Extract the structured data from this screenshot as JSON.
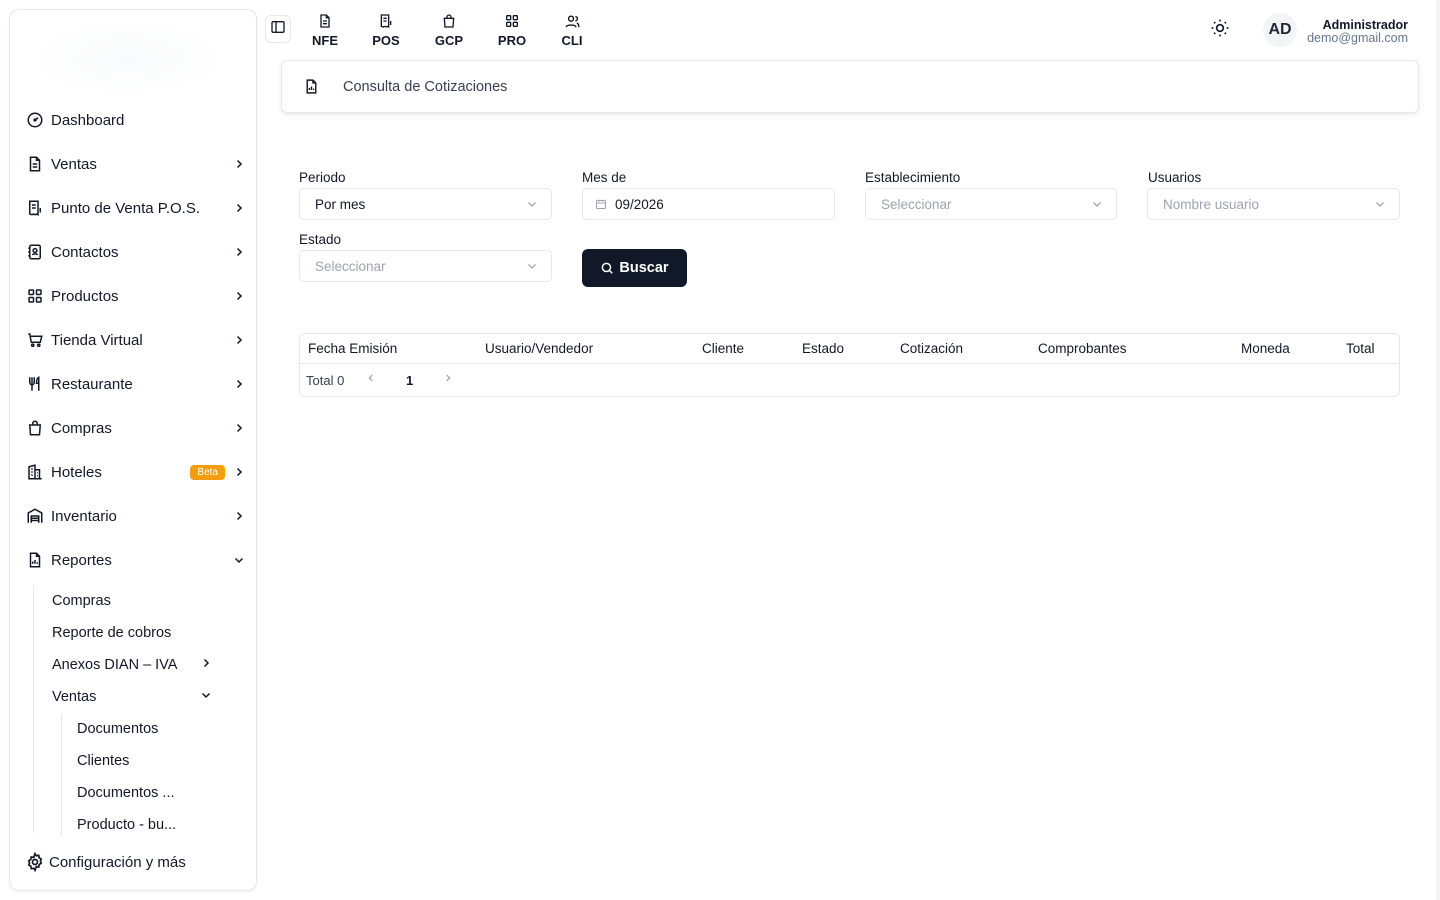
{
  "sidebar": {
    "items": [
      {
        "label": "Dashboard",
        "icon": "gauge-icon"
      },
      {
        "label": "Ventas",
        "icon": "document-icon"
      },
      {
        "label": "Punto de Venta P.O.S.",
        "icon": "receipt-icon"
      },
      {
        "label": "Contactos",
        "icon": "contacts-icon"
      },
      {
        "label": "Productos",
        "icon": "grid-icon"
      },
      {
        "label": "Tienda Virtual",
        "icon": "cart-icon"
      },
      {
        "label": "Restaurante",
        "icon": "utensils-icon"
      },
      {
        "label": "Compras",
        "icon": "shopping-bag-icon"
      },
      {
        "label": "Hoteles",
        "icon": "building-icon",
        "badge": "Beta"
      },
      {
        "label": "Inventario",
        "icon": "warehouse-icon"
      },
      {
        "label": "Reportes",
        "icon": "report-icon"
      }
    ],
    "reportes_sub": [
      {
        "label": "Compras"
      },
      {
        "label": "Reporte de cobros"
      },
      {
        "label": "Anexos DIAN – IVA"
      },
      {
        "label": "Ventas"
      }
    ],
    "ventas_sub": [
      {
        "label": "Documentos"
      },
      {
        "label": "Clientes"
      },
      {
        "label": "Documentos ..."
      },
      {
        "label": "Producto - bu..."
      }
    ],
    "settings_label": "Configuración y más"
  },
  "topbar": {
    "shortcuts": [
      {
        "label": "NFE",
        "icon": "document-icon"
      },
      {
        "label": "POS",
        "icon": "receipt-icon"
      },
      {
        "label": "GCP",
        "icon": "shopping-bag-icon"
      },
      {
        "label": "PRO",
        "icon": "grid-icon"
      },
      {
        "label": "CLI",
        "icon": "users-icon"
      }
    ],
    "avatar_initials": "AD",
    "user_name": "Administrador",
    "user_email": "demo@gmail.com"
  },
  "page": {
    "title": "Consulta de Cotizaciones"
  },
  "filters": {
    "periodo_label": "Periodo",
    "periodo_value": "Por mes",
    "mes_label": "Mes de",
    "mes_value": "09/2026",
    "establecimiento_label": "Establecimiento",
    "establecimiento_placeholder": "Seleccionar",
    "usuarios_label": "Usuarios",
    "usuarios_placeholder": "Nombre usuario",
    "estado_label": "Estado",
    "estado_placeholder": "Seleccionar",
    "search_label": "Buscar"
  },
  "table": {
    "columns": [
      "Fecha Emisión",
      "Usuario/Vendedor",
      "Cliente",
      "Estado",
      "Cotización",
      "Comprobantes",
      "Moneda",
      "Total"
    ],
    "rows": [],
    "total_text": "Total 0",
    "current_page": "1"
  },
  "colors": {
    "primary": "#111827",
    "badge": "#f59e0b",
    "border": "#e5e7eb",
    "muted": "#9ca3af"
  }
}
